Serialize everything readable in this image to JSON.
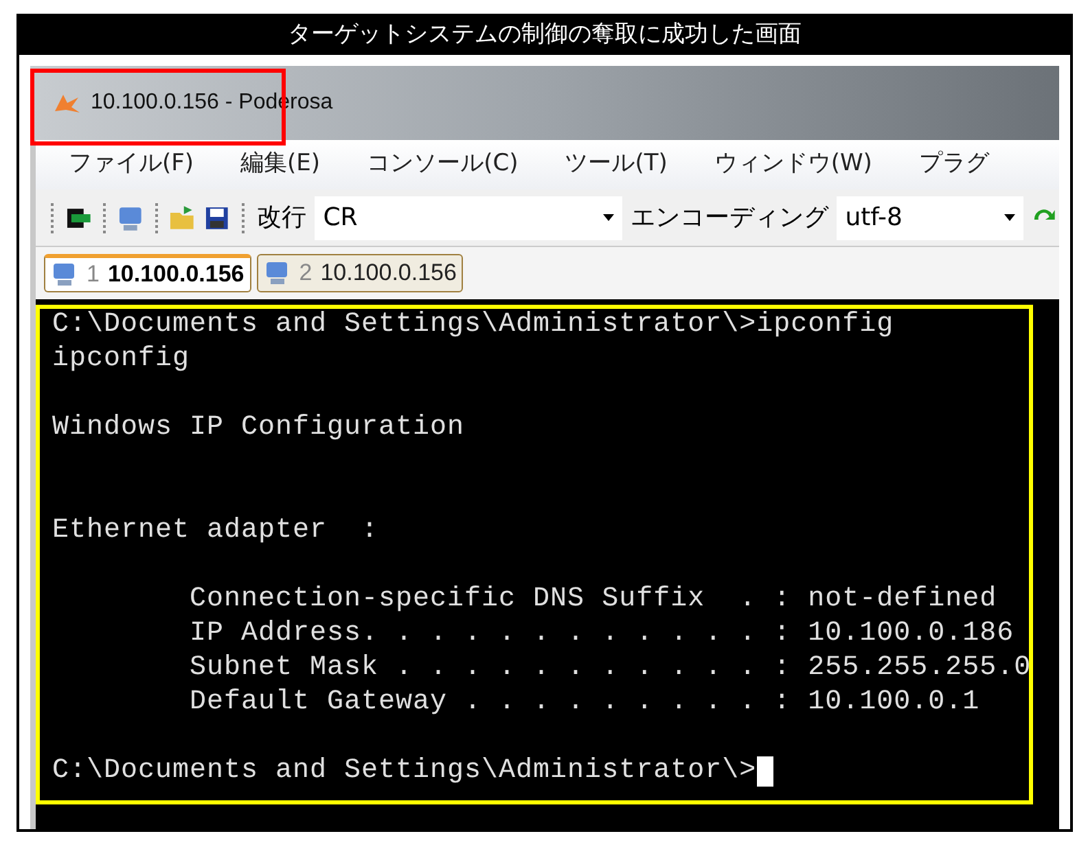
{
  "caption": "ターゲットシステムの制御の奪取に成功した画面",
  "window": {
    "title": "10.100.0.156 - Poderosa"
  },
  "menu": [
    "ファイル(F)",
    "編集(E)",
    "コンソール(C)",
    "ツール(T)",
    "ウィンドウ(W)",
    "プラグ"
  ],
  "toolbar": {
    "newline_label": "改行",
    "newline_value": "CR",
    "encoding_label": "エンコーディング",
    "encoding_value": "utf-8"
  },
  "tabs": [
    {
      "number": "1",
      "label": "10.100.0.156",
      "selected": true
    },
    {
      "number": "2",
      "label": "10.100.0.156",
      "selected": false
    }
  ],
  "terminal": [
    {
      "kind": "text",
      "text": "C:\\Documents and Settings\\Administrator\\>ipconfig"
    },
    {
      "kind": "text",
      "text": "ipconfig"
    },
    {
      "kind": "blank"
    },
    {
      "kind": "text",
      "text": "Windows IP Configuration"
    },
    {
      "kind": "blank"
    },
    {
      "kind": "blank"
    },
    {
      "kind": "text",
      "text": "Ethernet adapter  :"
    },
    {
      "kind": "blank"
    },
    {
      "kind": "text",
      "text": "        Connection-specific DNS Suffix  . : not-defined"
    },
    {
      "kind": "text",
      "text": "        IP Address. . . . . . . . . . . . : 10.100.0.186"
    },
    {
      "kind": "text",
      "text": "        Subnet Mask . . . . . . . . . . . : 255.255.255.0"
    },
    {
      "kind": "text",
      "text": "        Default Gateway . . . . . . . . . : 10.100.0.1"
    },
    {
      "kind": "blank"
    },
    {
      "kind": "prompt",
      "text": "C:\\Documents and Settings\\Administrator\\>",
      "cursor": true
    }
  ]
}
